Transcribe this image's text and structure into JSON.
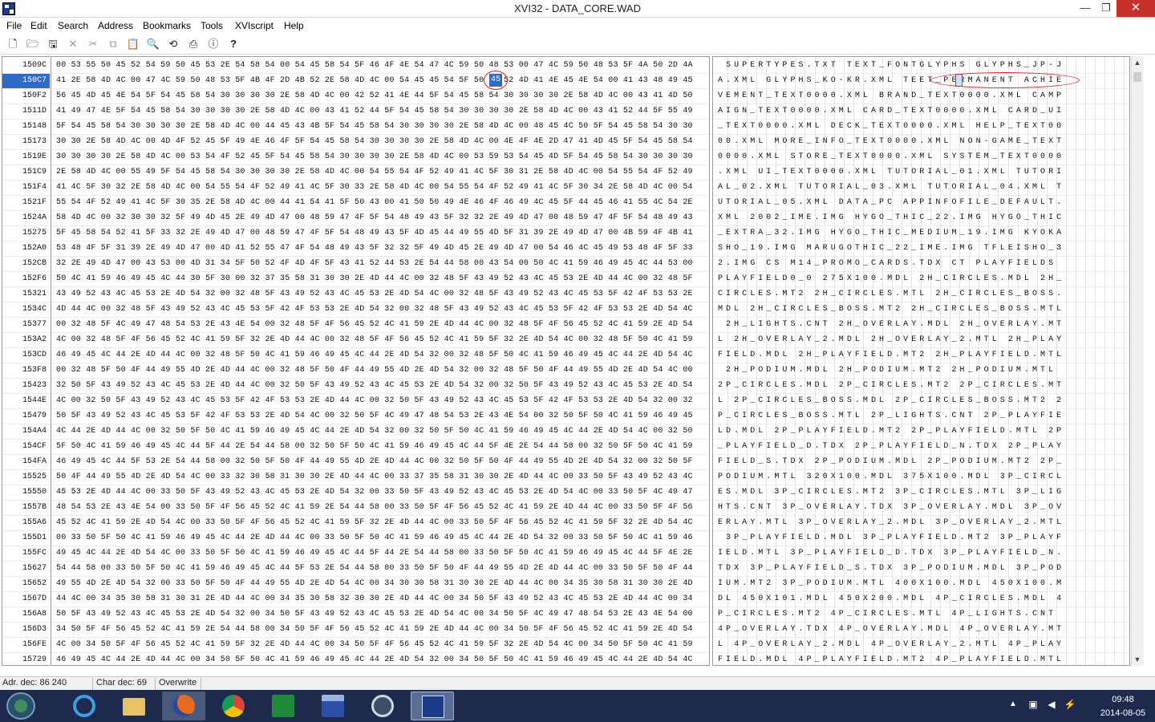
{
  "window": {
    "title": "XVI32 - DATA_CORE.WAD",
    "min_glyph": "—",
    "max_glyph": "❐",
    "close_glyph": "✕"
  },
  "menu": [
    "File",
    "Edit",
    "Search",
    "Address",
    "Bookmarks",
    "Tools",
    "XVIscript",
    "Help"
  ],
  "toolbar_icons": [
    "new-file-icon",
    "open-folder-icon",
    "save-disk-icon",
    "close-x-icon",
    "cut-icon",
    "copy-icon",
    "paste-icon",
    "find-icon",
    "find-replace-icon",
    "print-icon",
    "info-icon",
    "help-icon"
  ],
  "rows": [
    {
      "addr": "1509C",
      "hex": "00 53 55 50 45 52 54 59 50 45 53 2E 54 58 54 00 54 45 58 54 5F 46 4F 4E 54 47 4C 59 50 48 53 00 47 4C 59 50 48 53 5F 4A 50 2D 4A",
      "ascii": " SUPERTYPES.TXT TEXT_FONTGLYPHS GLYPHS_JP-J"
    },
    {
      "addr": "150C7",
      "hex": "41 2E 58 4D 4C 00 47 4C 59 50 48 53 5F 4B 4F 2D 4B 52 2E 58 4D 4C 00 54 45 45 54 5F 50 45 52 4D 41 4E 45 4E 54 00 41 43 48 49 45",
      "ascii": "A.XML GLYPHS_KO-KR.XML TEET_PERMANENT ACHIE"
    },
    {
      "addr": "150F2",
      "hex": "56 45 4D 45 4E 54 5F 54 45 58 54 30 30 30 30 2E 58 4D 4C 00 42 52 41 4E 44 5F 54 45 58 54 30 30 30 30 2E 58 4D 4C 00 43 41 4D 50",
      "ascii": "VEMENT_TEXT0000.XML BRAND_TEXT0000.XML CAMP"
    },
    {
      "addr": "1511D",
      "hex": "41 49 47 4E 5F 54 45 58 54 30 30 30 30 2E 58 4D 4C 00 43 41 52 44 5F 54 45 58 54 30 30 30 30 2E 58 4D 4C 00 43 41 52 44 5F 55 49",
      "ascii": "AIGN_TEXT0000.XML CARD_TEXT0000.XML CARD_UI"
    },
    {
      "addr": "15148",
      "hex": "5F 54 45 58 54 30 30 30 30 2E 58 4D 4C 00 44 45 43 4B 5F 54 45 58 54 30 30 30 30 2E 58 4D 4C 00 48 45 4C 50 5F 54 45 58 54 30 30",
      "ascii": "_TEXT0000.XML DECK_TEXT0000.XML HELP_TEXT00"
    },
    {
      "addr": "15173",
      "hex": "30 30 2E 58 4D 4C 00 4D 4F 52 45 5F 49 4E 46 4F 5F 54 45 58 54 30 30 30 30 2E 58 4D 4C 00 4E 4F 4E 2D 47 41 4D 45 5F 54 45 58 54",
      "ascii": "00.XML MORE_INFO_TEXT0000.XML NON-GAME_TEXT"
    },
    {
      "addr": "1519E",
      "hex": "30 30 30 30 2E 58 4D 4C 00 53 54 4F 52 45 5F 54 45 58 54 30 30 30 30 2E 58 4D 4C 00 53 59 53 54 45 4D 5F 54 45 58 54 30 30 30 30",
      "ascii": "0000.XML STORE_TEXT0000.XML SYSTEM_TEXT0000"
    },
    {
      "addr": "151C9",
      "hex": "2E 58 4D 4C 00 55 49 5F 54 45 58 54 30 30 30 30 2E 58 4D 4C 00 54 55 54 4F 52 49 41 4C 5F 30 31 2E 58 4D 4C 00 54 55 54 4F 52 49",
      "ascii": ".XML UI_TEXT0000.XML TUTORIAL_01.XML TUTORI"
    },
    {
      "addr": "151F4",
      "hex": "41 4C 5F 30 32 2E 58 4D 4C 00 54 55 54 4F 52 49 41 4C 5F 30 33 2E 58 4D 4C 00 54 55 54 4F 52 49 41 4C 5F 30 34 2E 58 4D 4C 00 54",
      "ascii": "AL_02.XML TUTORIAL_03.XML TUTORIAL_04.XML T"
    },
    {
      "addr": "1521F",
      "hex": "55 54 4F 52 49 41 4C 5F 30 35 2E 58 4D 4C 00 44 41 54 41 5F 50 43 00 41 50 50 49 4E 46 4F 46 49 4C 45 5F 44 45 46 41 55 4C 54 2E",
      "ascii": "UTORIAL_05.XML DATA_PC APPINFOFILE_DEFAULT."
    },
    {
      "addr": "1524A",
      "hex": "58 4D 4C 00 32 30 30 32 5F 49 4D 45 2E 49 4D 47 00 48 59 47 4F 5F 54 48 49 43 5F 32 32 2E 49 4D 47 00 48 59 47 4F 5F 54 48 49 43",
      "ascii": "XML 2002_IME.IMG HYGO_THIC_22.IMG HYGO_THIC"
    },
    {
      "addr": "15275",
      "hex": "5F 45 58 54 52 41 5F 33 32 2E 49 4D 47 00 48 59 47 4F 5F 54 48 49 43 5F 4D 45 44 49 55 4D 5F 31 39 2E 49 4D 47 00 4B 59 4F 4B 41",
      "ascii": "_EXTRA_32.IMG HYGO_THIC_MEDIUM_19.IMG KYOKA"
    },
    {
      "addr": "152A0",
      "hex": "53 48 4F 5F 31 39 2E 49 4D 47 00 4D 41 52 55 47 4F 54 48 49 43 5F 32 32 5F 49 4D 45 2E 49 4D 47 00 54 46 4C 45 49 53 48 4F 5F 33",
      "ascii": "SHO_19.IMG MARUGOTHIC_22_IME.IMG TFLEISHO_3"
    },
    {
      "addr": "152CB",
      "hex": "32 2E 49 4D 47 00 43 53 00 4D 31 34 5F 50 52 4F 4D 4F 5F 43 41 52 44 53 2E 54 44 58 00 43 54 00 50 4C 41 59 46 49 45 4C 44 53 00",
      "ascii": "2.IMG CS M14_PROMO_CARDS.TDX CT PLAYFIELDS "
    },
    {
      "addr": "152F6",
      "hex": "50 4C 41 59 46 49 45 4C 44 30 5F 30 00 32 37 35 58 31 30 30 2E 4D 44 4C 00 32 48 5F 43 49 52 43 4C 45 53 2E 4D 44 4C 00 32 48 5F",
      "ascii": "PLAYFIELD0_0 275X100.MDL 2H_CIRCLES.MDL 2H_"
    },
    {
      "addr": "15321",
      "hex": "43 49 52 43 4C 45 53 2E 4D 54 32 00 32 48 5F 43 49 52 43 4C 45 53 2E 4D 54 4C 00 32 48 5F 43 49 52 43 4C 45 53 5F 42 4F 53 53 2E",
      "ascii": "CIRCLES.MT2 2H_CIRCLES.MTL 2H_CIRCLES_BOSS."
    },
    {
      "addr": "1534C",
      "hex": "4D 44 4C 00 32 48 5F 43 49 52 43 4C 45 53 5F 42 4F 53 53 2E 4D 54 32 00 32 48 5F 43 49 52 43 4C 45 53 5F 42 4F 53 53 2E 4D 54 4C",
      "ascii": "MDL 2H_CIRCLES_BOSS.MT2 2H_CIRCLES_BOSS.MTL"
    },
    {
      "addr": "15377",
      "hex": "00 32 48 5F 4C 49 47 48 54 53 2E 43 4E 54 00 32 48 5F 4F 56 45 52 4C 41 59 2E 4D 44 4C 00 32 48 5F 4F 56 45 52 4C 41 59 2E 4D 54",
      "ascii": " 2H_LIGHTS.CNT 2H_OVERLAY.MDL 2H_OVERLAY.MT"
    },
    {
      "addr": "153A2",
      "hex": "4C 00 32 48 5F 4F 56 45 52 4C 41 59 5F 32 2E 4D 44 4C 00 32 48 5F 4F 56 45 52 4C 41 59 5F 32 2E 4D 54 4C 00 32 48 5F 50 4C 41 59",
      "ascii": "L 2H_OVERLAY_2.MDL 2H_OVERLAY_2.MTL 2H_PLAY"
    },
    {
      "addr": "153CD",
      "hex": "46 49 45 4C 44 2E 4D 44 4C 00 32 48 5F 50 4C 41 59 46 49 45 4C 44 2E 4D 54 32 00 32 48 5F 50 4C 41 59 46 49 45 4C 44 2E 4D 54 4C",
      "ascii": "FIELD.MDL 2H_PLAYFIELD.MT2 2H_PLAYFIELD.MTL"
    },
    {
      "addr": "153F8",
      "hex": "00 32 48 5F 50 4F 44 49 55 4D 2E 4D 44 4C 00 32 48 5F 50 4F 44 49 55 4D 2E 4D 54 32 00 32 48 5F 50 4F 44 49 55 4D 2E 4D 54 4C 00",
      "ascii": " 2H_PODIUM.MDL 2H_PODIUM.MT2 2H_PODIUM.MTL "
    },
    {
      "addr": "15423",
      "hex": "32 50 5F 43 49 52 43 4C 45 53 2E 4D 44 4C 00 32 50 5F 43 49 52 43 4C 45 53 2E 4D 54 32 00 32 50 5F 43 49 52 43 4C 45 53 2E 4D 54",
      "ascii": "2P_CIRCLES.MDL 2P_CIRCLES.MT2 2P_CIRCLES.MT"
    },
    {
      "addr": "1544E",
      "hex": "4C 00 32 50 5F 43 49 52 43 4C 45 53 5F 42 4F 53 53 2E 4D 44 4C 00 32 50 5F 43 49 52 43 4C 45 53 5F 42 4F 53 53 2E 4D 54 32 00 32",
      "ascii": "L 2P_CIRCLES_BOSS.MDL 2P_CIRCLES_BOSS.MT2 2"
    },
    {
      "addr": "15479",
      "hex": "50 5F 43 49 52 43 4C 45 53 5F 42 4F 53 53 2E 4D 54 4C 00 32 50 5F 4C 49 47 48 54 53 2E 43 4E 54 00 32 50 5F 50 4C 41 59 46 49 45",
      "ascii": "P_CIRCLES_BOSS.MTL 2P_LIGHTS.CNT 2P_PLAYFIE"
    },
    {
      "addr": "154A4",
      "hex": "4C 44 2E 4D 44 4C 00 32 50 5F 50 4C 41 59 46 49 45 4C 44 2E 4D 54 32 00 32 50 5F 50 4C 41 59 46 49 45 4C 44 2E 4D 54 4C 00 32 50",
      "ascii": "LD.MDL 2P_PLAYFIELD.MT2 2P_PLAYFIELD.MTL 2P"
    },
    {
      "addr": "154CF",
      "hex": "5F 50 4C 41 59 46 49 45 4C 44 5F 44 2E 54 44 58 00 32 50 5F 50 4C 41 59 46 49 45 4C 44 5F 4E 2E 54 44 58 00 32 50 5F 50 4C 41 59",
      "ascii": "_PLAYFIELD_D.TDX 2P_PLAYFIELD_N.TDX 2P_PLAY"
    },
    {
      "addr": "154FA",
      "hex": "46 49 45 4C 44 5F 53 2E 54 44 58 00 32 50 5F 50 4F 44 49 55 4D 2E 4D 44 4C 00 32 50 5F 50 4F 44 49 55 4D 2E 4D 54 32 00 32 50 5F",
      "ascii": "FIELD_S.TDX 2P_PODIUM.MDL 2P_PODIUM.MT2 2P_"
    },
    {
      "addr": "15525",
      "hex": "50 4F 44 49 55 4D 2E 4D 54 4C 00 33 32 30 58 31 30 30 2E 4D 44 4C 00 33 37 35 58 31 30 30 2E 4D 44 4C 00 33 50 5F 43 49 52 43 4C",
      "ascii": "PODIUM.MTL 320X100.MDL 375X100.MDL 3P_CIRCL"
    },
    {
      "addr": "15550",
      "hex": "45 53 2E 4D 44 4C 00 33 50 5F 43 49 52 43 4C 45 53 2E 4D 54 32 00 33 50 5F 43 49 52 43 4C 45 53 2E 4D 54 4C 00 33 50 5F 4C 49 47",
      "ascii": "ES.MDL 3P_CIRCLES.MT2 3P_CIRCLES.MTL 3P_LIG"
    },
    {
      "addr": "1557B",
      "hex": "48 54 53 2E 43 4E 54 00 33 50 5F 4F 56 45 52 4C 41 59 2E 54 44 58 00 33 50 5F 4F 56 45 52 4C 41 59 2E 4D 44 4C 00 33 50 5F 4F 56",
      "ascii": "HTS.CNT 3P_OVERLAY.TDX 3P_OVERLAY.MDL 3P_OV"
    },
    {
      "addr": "155A6",
      "hex": "45 52 4C 41 59 2E 4D 54 4C 00 33 50 5F 4F 56 45 52 4C 41 59 5F 32 2E 4D 44 4C 00 33 50 5F 4F 56 45 52 4C 41 59 5F 32 2E 4D 54 4C",
      "ascii": "ERLAY.MTL 3P_OVERLAY_2.MDL 3P_OVERLAY_2.MTL"
    },
    {
      "addr": "155D1",
      "hex": "00 33 50 5F 50 4C 41 59 46 49 45 4C 44 2E 4D 44 4C 00 33 50 5F 50 4C 41 59 46 49 45 4C 44 2E 4D 54 32 00 33 50 5F 50 4C 41 59 46",
      "ascii": " 3P_PLAYFIELD.MDL 3P_PLAYFIELD.MT2 3P_PLAYF"
    },
    {
      "addr": "155FC",
      "hex": "49 45 4C 44 2E 4D 54 4C 00 33 50 5F 50 4C 41 59 46 49 45 4C 44 5F 44 2E 54 44 58 00 33 50 5F 50 4C 41 59 46 49 45 4C 44 5F 4E 2E",
      "ascii": "IELD.MTL 3P_PLAYFIELD_D.TDX 3P_PLAYFIELD_N."
    },
    {
      "addr": "15627",
      "hex": "54 44 58 00 33 50 5F 50 4C 41 59 46 49 45 4C 44 5F 53 2E 54 44 58 00 33 50 5F 50 4F 44 49 55 4D 2E 4D 44 4C 00 33 50 5F 50 4F 44",
      "ascii": "TDX 3P_PLAYFIELD_S.TDX 3P_PODIUM.MDL 3P_POD"
    },
    {
      "addr": "15652",
      "hex": "49 55 4D 2E 4D 54 32 00 33 50 5F 50 4F 44 49 55 4D 2E 4D 54 4C 00 34 30 30 58 31 30 30 2E 4D 44 4C 00 34 35 30 58 31 30 30 2E 4D",
      "ascii": "IUM.MT2 3P_PODIUM.MTL 400X100.MDL 450X100.M"
    },
    {
      "addr": "1567D",
      "hex": "44 4C 00 34 35 30 58 31 30 31 2E 4D 44 4C 00 34 35 30 58 32 30 30 2E 4D 44 4C 00 34 50 5F 43 49 52 43 4C 45 53 2E 4D 44 4C 00 34",
      "ascii": "DL 450X101.MDL 450X200.MDL 4P_CIRCLES.MDL 4"
    },
    {
      "addr": "156A8",
      "hex": "50 5F 43 49 52 43 4C 45 53 2E 4D 54 32 00 34 50 5F 43 49 52 43 4C 45 53 2E 4D 54 4C 00 34 50 5F 4C 49 47 48 54 53 2E 43 4E 54 00",
      "ascii": "P_CIRCLES.MT2 4P_CIRCLES.MTL 4P_LIGHTS.CNT "
    },
    {
      "addr": "156D3",
      "hex": "34 50 5F 4F 56 45 52 4C 41 59 2E 54 44 58 00 34 50 5F 4F 56 45 52 4C 41 59 2E 4D 44 4C 00 34 50 5F 4F 56 45 52 4C 41 59 2E 4D 54",
      "ascii": "4P_OVERLAY.TDX 4P_OVERLAY.MDL 4P_OVERLAY.MT"
    },
    {
      "addr": "156FE",
      "hex": "4C 00 34 50 5F 4F 56 45 52 4C 41 59 5F 32 2E 4D 44 4C 00 34 50 5F 4F 56 45 52 4C 41 59 5F 32 2E 4D 54 4C 00 34 50 5F 50 4C 41 59",
      "ascii": "L 4P_OVERLAY_2.MDL 4P_OVERLAY_2.MTL 4P_PLAY"
    },
    {
      "addr": "15729",
      "hex": "46 49 45 4C 44 2E 4D 44 4C 00 34 50 5F 50 4C 41 59 46 49 45 4C 44 2E 4D 54 32 00 34 50 5F 50 4C 41 59 46 49 45 4C 44 2E 4D 54 4C",
      "ascii": "FIELD.MDL 4P_PLAYFIELD.MT2 4P_PLAYFIELD.MTL"
    }
  ],
  "selection": {
    "hex_byte": "45",
    "ascii_char": "E",
    "row_index": 1,
    "col_index": 24
  },
  "status": {
    "adr": "Adr. dec: 86 240",
    "char": "Char dec: 69",
    "mode": "Overwrite"
  },
  "scroll": {
    "up": "▲",
    "down": "▼"
  },
  "taskbar": {
    "apps": [
      "internet-explorer",
      "file-explorer",
      "firefox",
      "chrome",
      "excel",
      "floppy-save",
      "steam",
      "xvi32"
    ],
    "time": "09:48",
    "date": "2014-08-05"
  },
  "colors": {
    "selection": "#2f6bc6",
    "annotation": "#d22222",
    "taskbar": "#1d2a4e"
  }
}
